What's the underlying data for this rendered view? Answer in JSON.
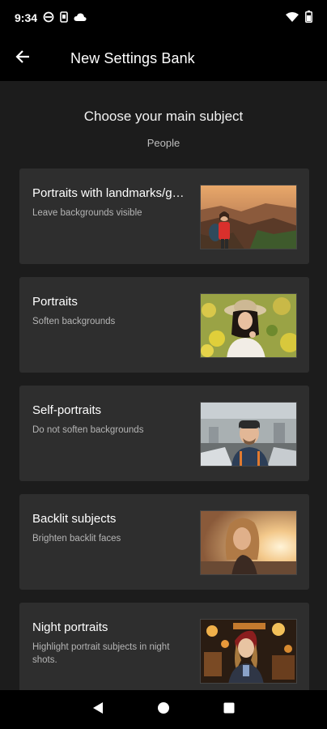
{
  "status_bar": {
    "time": "9:34",
    "icons": [
      "vpn-icon",
      "phone-icon",
      "cloud-icon",
      "wifi-icon",
      "battery-icon"
    ]
  },
  "app_bar": {
    "title": "New Settings Bank",
    "back_icon": "arrow-back-icon"
  },
  "main": {
    "heading": "Choose your main subject",
    "subheading": "People",
    "options": [
      {
        "title": "Portraits with landmarks/g…",
        "description": "Leave backgrounds visible",
        "image": "hiker-with-landmark-photo"
      },
      {
        "title": "Portraits",
        "description": "Soften backgrounds",
        "image": "woman-in-flowers-photo"
      },
      {
        "title": "Self-portraits",
        "description": "Do not soften backgrounds",
        "image": "selfie-man-photo"
      },
      {
        "title": "Backlit subjects",
        "description": "Brighten backlit faces",
        "image": "backlit-woman-photo"
      },
      {
        "title": "Night portraits",
        "description": "Highlight portrait subjects in night shots.",
        "image": "night-woman-photo"
      }
    ]
  },
  "nav_bar": {
    "icons": [
      "back-triangle-icon",
      "home-circle-icon",
      "recents-square-icon"
    ]
  },
  "colors": {
    "bar_background": "#000000",
    "page_background": "#1c1c1c",
    "card_background": "#2e2e2e",
    "primary_text": "#ffffff",
    "secondary_text": "#b5b5b5"
  }
}
